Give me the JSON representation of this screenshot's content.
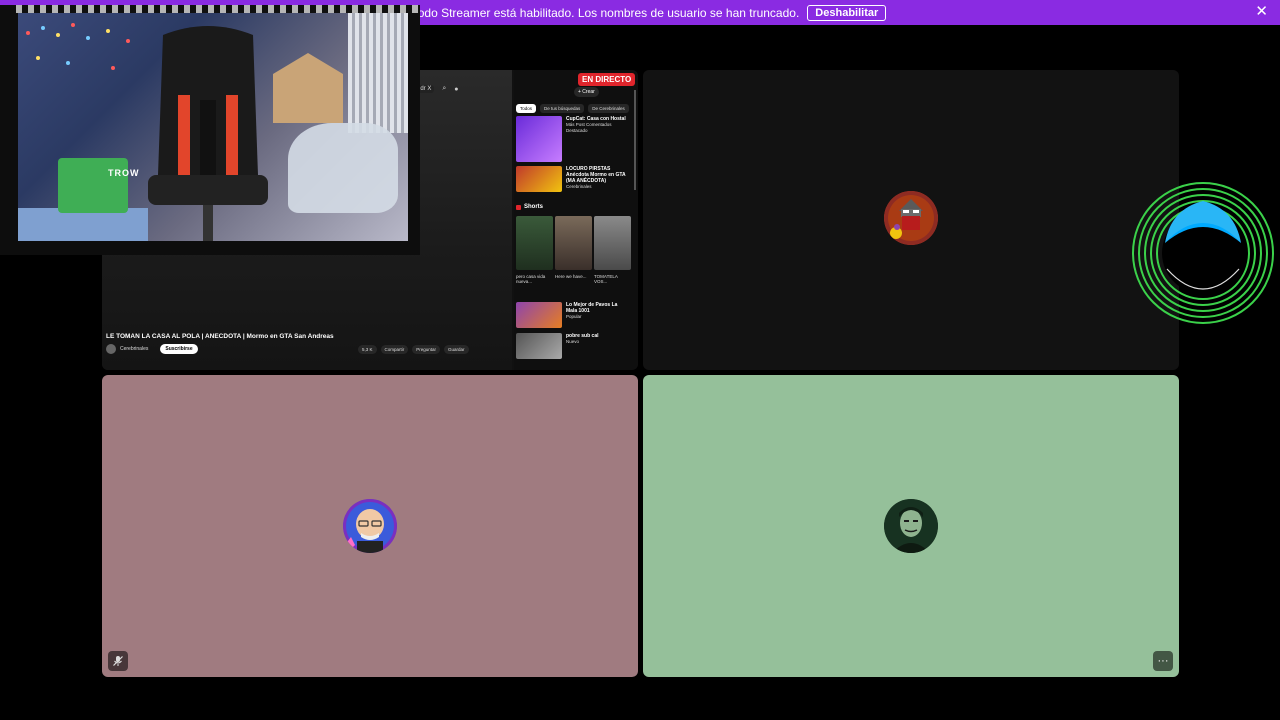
{
  "banner": {
    "message": "El modo Streamer está habilitado. Los nombres de usuario se han truncado.",
    "button_label": "Deshabilitar",
    "close_symbol": "✕",
    "background_color": "#8a2be2"
  },
  "screen_share": {
    "live_badge": "EN DIRECTO",
    "search_text": "on Andr X",
    "create_label": "+ Crear",
    "tabs": [
      "Todos",
      "De tus búsquedas",
      "De Cerebrinales"
    ],
    "recommendations": [
      {
        "title": "CupCat: Casa con Hostal",
        "meta": "Más Post Comentados",
        "badge": "Destacado"
      },
      {
        "title": "LOCURO PIRSTAS Anécdota Mormo en GTA (MA ANÉCDOTA)",
        "meta": "Cerebrinales"
      }
    ],
    "shorts_title": "Shorts",
    "shorts_captions": [
      "pero casa vida nueva...",
      "Here we have...",
      "TOMATELA VOS..."
    ],
    "more_recommendations": [
      {
        "title": "Lo Mejor de Pavos La Mala 1001",
        "meta": "Popular"
      },
      {
        "title": "pobre sub cal",
        "meta": "Nuevo"
      }
    ],
    "video_title": "LE TOMAN LA CASA AL POLA | ANECDOTA | Mormo en GTA San Andreas",
    "channel_name": "Cerebrinales",
    "subscribe_label": "Suscribirse",
    "actions": [
      "5,3 K",
      "Compartir",
      "Preguntar",
      "Guardar"
    ]
  },
  "webcam": {
    "brand_text": "TROW"
  },
  "tiles": {
    "bottom_left_color": "#a07b80",
    "bottom_right_color": "#95c09a",
    "top_right_color": "#121212"
  },
  "icons": {
    "muted_mic": "mic-off-icon",
    "more": "more-icon"
  },
  "more_glyph": "···"
}
